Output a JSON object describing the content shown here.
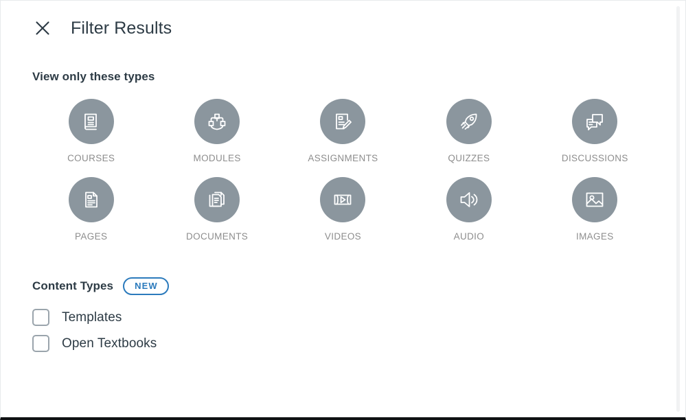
{
  "header": {
    "close_icon": "close-icon",
    "title": "Filter Results"
  },
  "types_section": {
    "heading": "View only these types",
    "items": [
      {
        "label": "COURSES",
        "icon": "book-icon"
      },
      {
        "label": "MODULES",
        "icon": "modules-hierarchy-icon"
      },
      {
        "label": "ASSIGNMENTS",
        "icon": "document-pencil-icon"
      },
      {
        "label": "QUIZZES",
        "icon": "rocket-icon"
      },
      {
        "label": "DISCUSSIONS",
        "icon": "speech-bubbles-icon"
      },
      {
        "label": "PAGES",
        "icon": "page-icon"
      },
      {
        "label": "DOCUMENTS",
        "icon": "stacked-documents-icon"
      },
      {
        "label": "VIDEOS",
        "icon": "video-play-icon"
      },
      {
        "label": "AUDIO",
        "icon": "speaker-icon"
      },
      {
        "label": "IMAGES",
        "icon": "image-icon"
      }
    ]
  },
  "content_types_section": {
    "heading": "Content Types",
    "badge": "NEW",
    "checkboxes": [
      {
        "label": "Templates",
        "checked": false
      },
      {
        "label": "Open Textbooks",
        "checked": false
      }
    ]
  },
  "colors": {
    "icon_circle": "#8b969e",
    "heading_text": "#2d3b45",
    "type_label": "#8d8d8d",
    "badge_blue": "#2b7abc",
    "checkbox_border": "#9aa4ac"
  }
}
